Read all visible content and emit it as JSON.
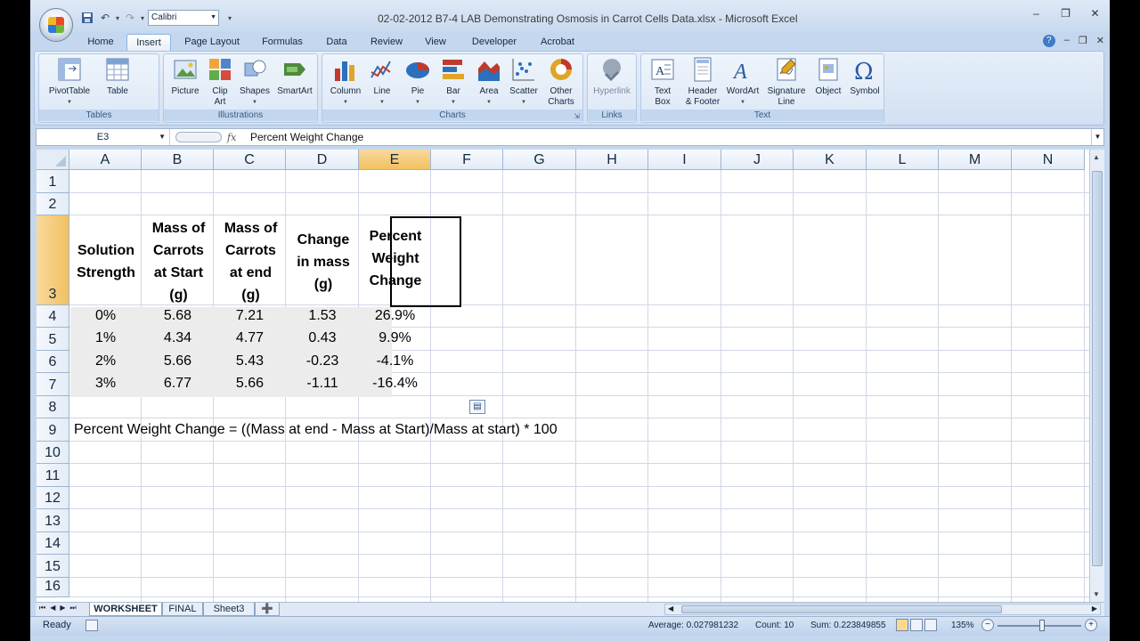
{
  "window": {
    "title": "02-02-2012 B7-4 LAB Demonstrating Osmosis in Carrot Cells Data.xlsx - Microsoft Excel",
    "controls": [
      "–",
      "❒",
      "✕"
    ],
    "doc_controls": [
      "–",
      "❒",
      "✕"
    ]
  },
  "qat": {
    "font": "Calibri",
    "icons": [
      "save-icon",
      "undo-icon",
      "redo-icon"
    ]
  },
  "tabs": [
    "Home",
    "Insert",
    "Page Layout",
    "Formulas",
    "Data",
    "Review",
    "View",
    "Developer",
    "Acrobat"
  ],
  "active_tab": "Insert",
  "ribbon": {
    "groups": {
      "tables": "Tables",
      "illustrations": "Illustrations",
      "charts": "Charts",
      "links": "Links",
      "text": "Text"
    },
    "buttons": {
      "pivottable": "PivotTable",
      "table": "Table",
      "picture": "Picture",
      "clipart_1": "Clip",
      "clipart_2": "Art",
      "shapes": "Shapes",
      "smartart": "SmartArt",
      "column": "Column",
      "line": "Line",
      "pie": "Pie",
      "bar": "Bar",
      "area": "Area",
      "scatter": "Scatter",
      "other_1": "Other",
      "other_2": "Charts",
      "hyperlink": "Hyperlink",
      "textbox_1": "Text",
      "textbox_2": "Box",
      "header_1": "Header",
      "header_2": "& Footer",
      "wordart": "WordArt",
      "signature_1": "Signature",
      "signature_2": "Line",
      "object": "Object",
      "symbol": "Symbol"
    }
  },
  "formula_bar": {
    "name_box": "E3",
    "fx": "fx",
    "content": "Percent Weight Change"
  },
  "grid": {
    "columns": [
      "A",
      "B",
      "C",
      "D",
      "E",
      "F",
      "G",
      "H",
      "I",
      "J",
      "K",
      "L",
      "M",
      "N"
    ],
    "rows": [
      "1",
      "2",
      "3",
      "4",
      "5",
      "6",
      "7",
      "8",
      "9",
      "10",
      "11",
      "12",
      "13",
      "14",
      "15",
      "16"
    ],
    "selected_column": "E",
    "selected_row": "3",
    "header_cells": {
      "a3": [
        "Solution",
        "Strength"
      ],
      "b3": [
        "Mass of",
        "Carrots",
        "at Start",
        "(g)"
      ],
      "c3": [
        "Mass of",
        "Carrots",
        "at end",
        "(g)"
      ],
      "d3": [
        "Change",
        "in mass",
        "(g)"
      ],
      "e3": [
        "Percent",
        "Weight",
        "Change"
      ]
    },
    "data_rows": [
      [
        "0%",
        "5.68",
        "7.21",
        "1.53",
        "26.9%"
      ],
      [
        "1%",
        "4.34",
        "4.77",
        "0.43",
        "9.9%"
      ],
      [
        "2%",
        "5.66",
        "5.43",
        "-0.23",
        "-4.1%"
      ],
      [
        "3%",
        "6.77",
        "5.66",
        "-1.11",
        "-16.4%"
      ]
    ],
    "row9_text": "Percent Weight Change = ((Mass at end - Mass at Start)/Mass at start) * 100"
  },
  "sheets": [
    "WORKSHEET",
    "FINAL",
    "Sheet3"
  ],
  "active_sheet": "WORKSHEET",
  "status": {
    "ready": "Ready",
    "average": "Average: 0.027981232",
    "count": "Count: 10",
    "sum": "Sum: 0.223849855",
    "zoom": "135%"
  }
}
